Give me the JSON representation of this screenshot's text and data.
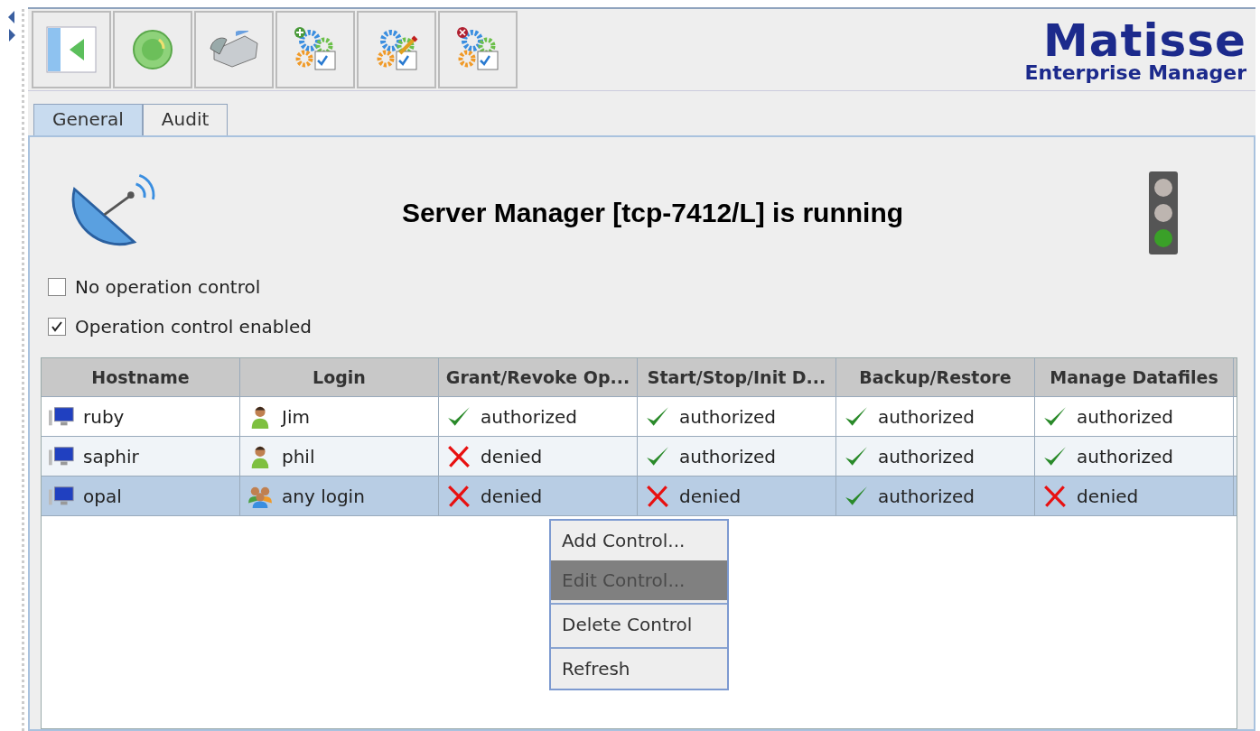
{
  "toolbar": {
    "buttons": [
      {
        "kind": "panel"
      },
      {
        "kind": "refresh"
      },
      {
        "kind": "phone"
      },
      {
        "kind": "add"
      },
      {
        "kind": "edit"
      },
      {
        "kind": "remove"
      }
    ]
  },
  "logo": {
    "title": "Matisse",
    "subtitle": "Enterprise Manager"
  },
  "tabs": [
    {
      "label": "General",
      "selected": true
    },
    {
      "label": "Audit",
      "selected": false
    }
  ],
  "status": {
    "title": "Server Manager [tcp-7412/L] is running"
  },
  "options": [
    {
      "label": "No operation control",
      "checked": false
    },
    {
      "label": "Operation control enabled",
      "checked": true
    }
  ],
  "table": {
    "columns": [
      "Hostname",
      "Login",
      "Grant/Revoke Op...",
      "Start/Stop/Init D...",
      "Backup/Restore",
      "Manage Datafiles"
    ],
    "rows": [
      {
        "selected": false,
        "host": "ruby",
        "login": {
          "text": "Jim",
          "kind": "user"
        },
        "perms": [
          {
            "text": "authorized",
            "kind": "allow"
          },
          {
            "text": "authorized",
            "kind": "allow"
          },
          {
            "text": "authorized",
            "kind": "allow"
          },
          {
            "text": "authorized",
            "kind": "allow"
          }
        ]
      },
      {
        "selected": false,
        "host": "saphir",
        "login": {
          "text": "phil",
          "kind": "user"
        },
        "perms": [
          {
            "text": "denied",
            "kind": "deny"
          },
          {
            "text": "authorized",
            "kind": "allow"
          },
          {
            "text": "authorized",
            "kind": "allow"
          },
          {
            "text": "authorized",
            "kind": "allow"
          }
        ]
      },
      {
        "selected": true,
        "host": "opal",
        "login": {
          "text": "any login",
          "kind": "group"
        },
        "perms": [
          {
            "text": "denied",
            "kind": "deny"
          },
          {
            "text": "denied",
            "kind": "deny"
          },
          {
            "text": "authorized",
            "kind": "allow"
          },
          {
            "text": "denied",
            "kind": "deny"
          }
        ]
      }
    ]
  },
  "context_menu": {
    "items": [
      {
        "label": "Add Control...",
        "selected": false
      },
      {
        "label": "Edit Control...",
        "selected": true
      },
      {
        "label": "Delete Control",
        "selected": false
      },
      {
        "label": "Refresh",
        "selected": false
      }
    ]
  }
}
